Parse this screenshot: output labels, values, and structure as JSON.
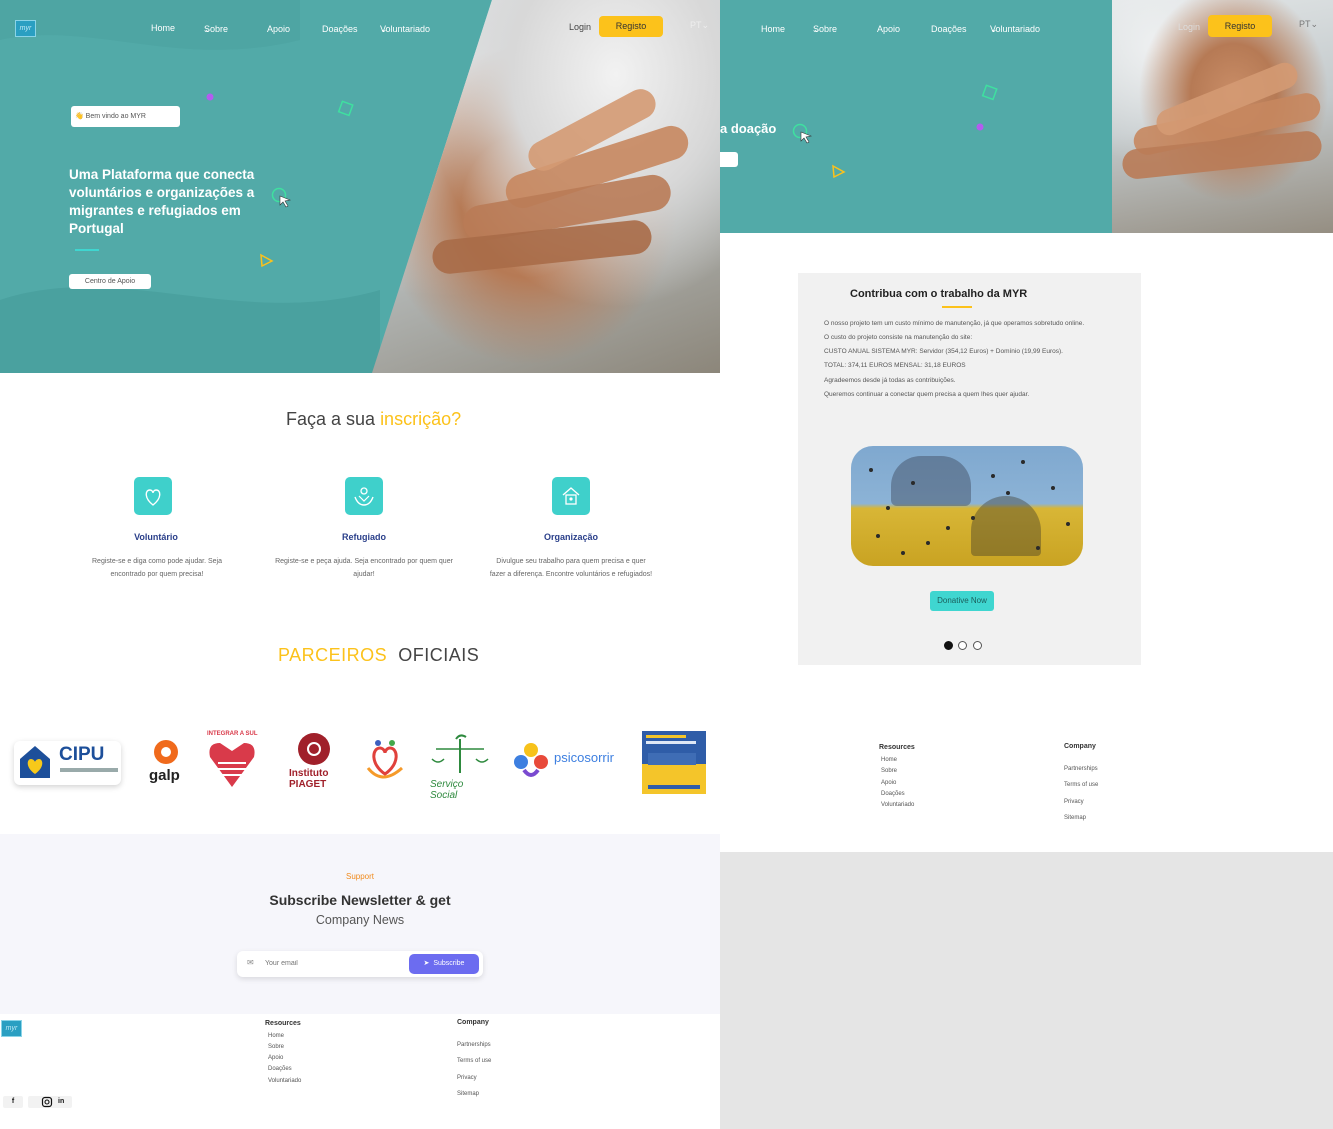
{
  "nav": {
    "items": [
      "Home",
      "Sobre",
      "Apoio",
      "Doações",
      "Voluntariado"
    ],
    "login": "Login",
    "registo": "Registo",
    "lang": "PT"
  },
  "hero": {
    "welcome": "👋 Bem vindo ao  MYR",
    "title": "Uma Plataforma que conecta voluntários e organizações a migrantes e refugiados em Portugal",
    "cta": "Centro de Apoio"
  },
  "signup": {
    "title_main": "Faça a sua ",
    "title_highlight": "inscrição?",
    "features": [
      {
        "title": "Voluntário",
        "desc": "Registe-se e diga como pode ajudar. Seja encontrado por quem precisa!"
      },
      {
        "title": "Refugiado",
        "desc": "Registe-se e peça ajuda. Seja encontrado por quem quer ajudar!"
      },
      {
        "title": "Organização",
        "desc": "Divulgue seu trabalho para quem precisa e quer fazer a diferença. Encontre voluntários e refugiados!"
      }
    ]
  },
  "partners": {
    "title_a": "PARCEIROS",
    "title_b": "OFICIAIS",
    "logos": [
      "CIPU",
      "galp",
      "INTEGRAR A SUL",
      "Instituto PIAGET",
      "",
      "Serviço Social",
      "psicosorrir",
      ""
    ]
  },
  "newsletter": {
    "support": "Support",
    "title": "Subscribe Newsletter & get",
    "subtitle": "Company News",
    "placeholder": "Your email",
    "button": "Subscribe"
  },
  "footer": {
    "resources_title": "Resources",
    "resources": [
      "Home",
      "Sobre",
      "Apoio",
      "Doações",
      "Voluntariado"
    ],
    "company_title": "Company",
    "company": [
      "Partnerships",
      "Terms of use",
      "Privacy",
      "Sitemap"
    ],
    "social": [
      "f",
      "in"
    ]
  },
  "right": {
    "hero_text": "a doação",
    "contrib_title": "Contribua com o trabalho da MYR",
    "contrib_lines": [
      "O nosso projeto tem um custo mínimo de manutenção, já que operamos sobretudo online.",
      "O custo do projeto consiste na manutenção do site:",
      "CUSTO ANUAL SISTEMA MYR: Servidor (354,12 Euros) + Domínio (19,99 Euros).",
      "TOTAL: 374,11 EUROS MENSAL: 31,18 EUROS",
      "Agradeemos desde já todas as contribuições.",
      "Queremos continuar a conectar quem precisa a quem lhes quer ajudar."
    ],
    "donate": "Donative Now"
  },
  "colors": {
    "teal": "#52aaa8",
    "accent_yellow": "#fcc21b",
    "icon_teal": "#3fd0cb",
    "subscribe_purple": "#6c6cf0"
  }
}
